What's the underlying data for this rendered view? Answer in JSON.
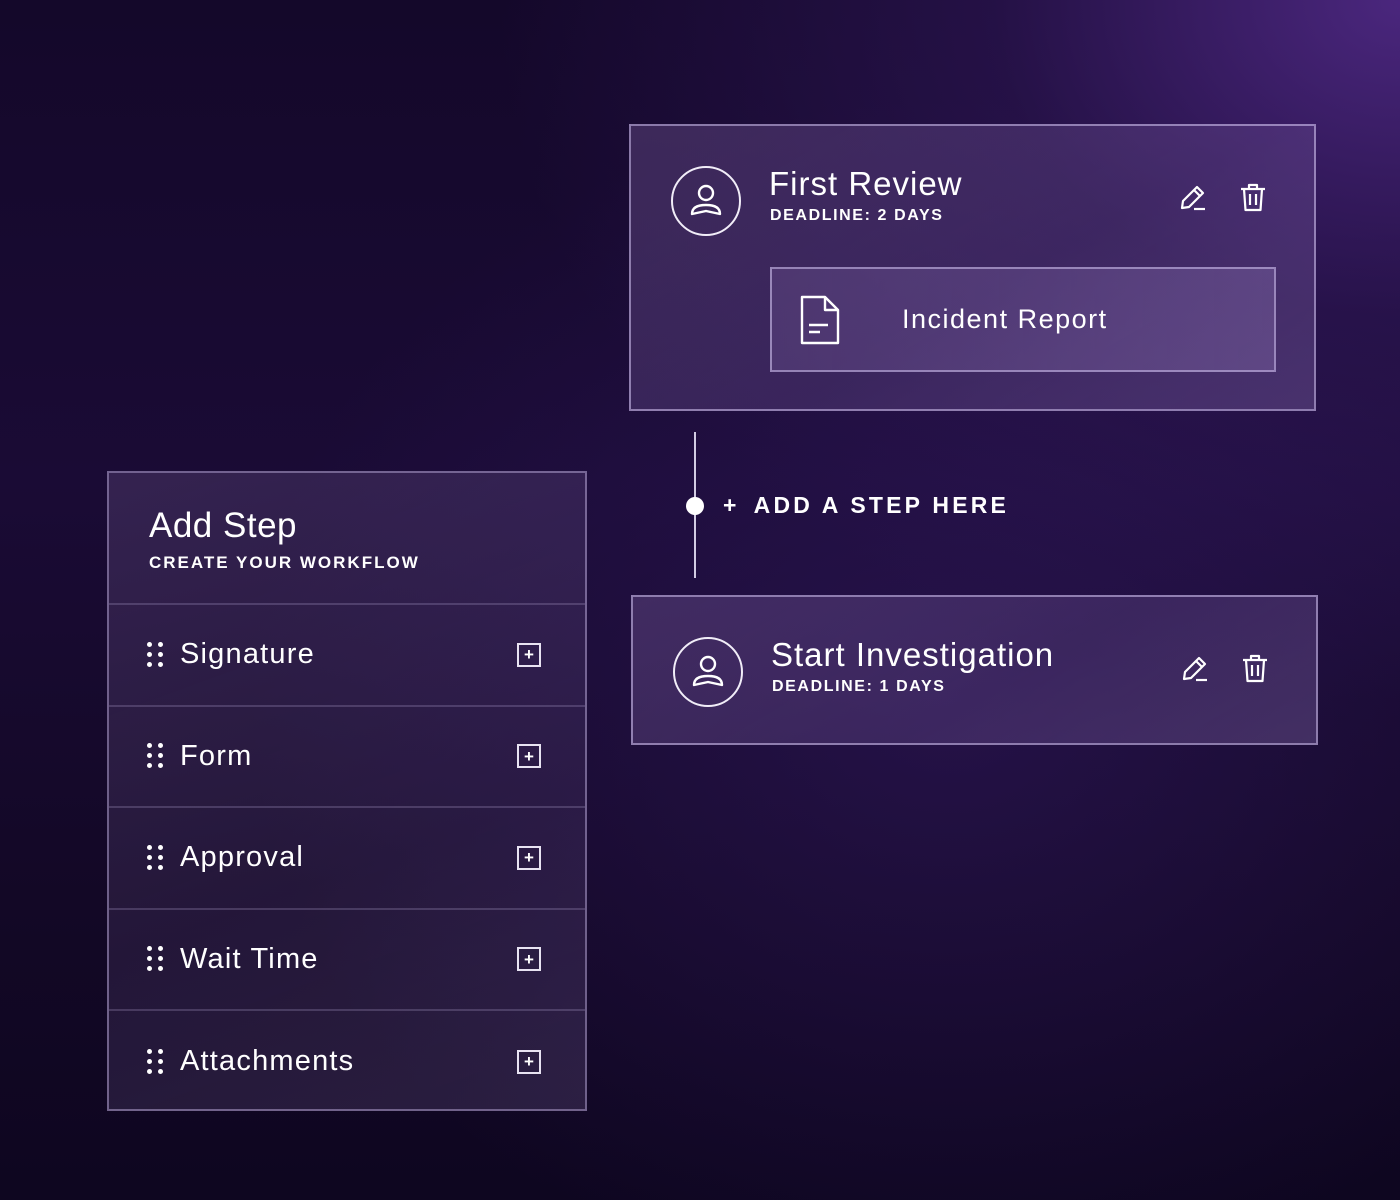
{
  "add_step_panel": {
    "title": "Add Step",
    "subtitle": "CREATE YOUR WORKFLOW",
    "items": [
      {
        "label": "Signature",
        "add_symbol": "+"
      },
      {
        "label": "Form",
        "add_symbol": "+"
      },
      {
        "label": "Approval",
        "add_symbol": "+"
      },
      {
        "label": "Wait Time",
        "add_symbol": "+"
      },
      {
        "label": "Attachments",
        "add_symbol": "+"
      }
    ]
  },
  "workflow": {
    "steps": [
      {
        "title": "First Review",
        "deadline": "DEADLINE: 2 DAYS",
        "attachment": "Incident Report",
        "icons": [
          "user-avatar-icon",
          "pencil-icon",
          "trash-icon",
          "document-icon"
        ]
      },
      {
        "title": "Start Investigation",
        "deadline": "DEADLINE: 1 DAYS",
        "icons": [
          "user-avatar-icon",
          "pencil-icon",
          "trash-icon"
        ]
      }
    ],
    "connector": {
      "plus": "+",
      "label": "ADD A STEP HERE"
    }
  },
  "colors": {
    "background_dark": "#14082a",
    "background_accent": "#542c8c",
    "text": "#ffffff",
    "border": "#d2c3f0"
  }
}
